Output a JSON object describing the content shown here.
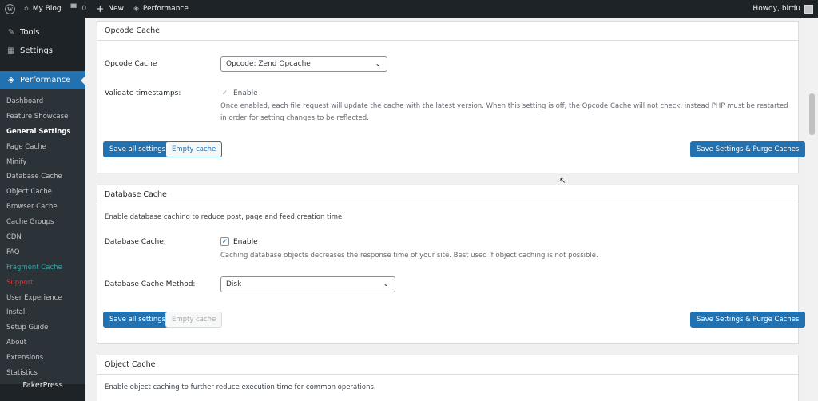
{
  "adminbar": {
    "site_name": "My Blog",
    "comments_count": "0",
    "new_label": "New",
    "performance_label": "Performance",
    "howdy": "Howdy, birdu"
  },
  "sidebar": {
    "tools": "Tools",
    "settings": "Settings",
    "performance": "Performance",
    "items": [
      "Dashboard",
      "Feature Showcase",
      "General Settings",
      "Page Cache",
      "Minify",
      "Database Cache",
      "Object Cache",
      "Browser Cache",
      "Cache Groups",
      "CDN",
      "FAQ",
      "Fragment Cache",
      "Support",
      "User Experience",
      "Install",
      "Setup Guide",
      "About",
      "Extensions",
      "Statistics"
    ],
    "fakerpress": "FakerPress"
  },
  "opcode": {
    "title": "Opcode Cache",
    "cache_label": "Opcode Cache",
    "cache_value": "Opcode: Zend Opcache",
    "validate_label": "Validate timestamps:",
    "enable_label": "Enable",
    "description": "Once enabled, each file request will update the cache with the latest version. When this setting is off, the Opcode Cache will not check, instead PHP must be restarted in order for setting changes to be reflected.",
    "save_all": "Save all settings",
    "empty_cache": "Empty cache",
    "save_purge": "Save Settings & Purge Caches"
  },
  "dbcache": {
    "title": "Database Cache",
    "intro": "Enable database caching to reduce post, page and feed creation time.",
    "cache_label": "Database Cache:",
    "enable_label": "Enable",
    "description": "Caching database objects decreases the response time of your site. Best used if object caching is not possible.",
    "method_label": "Database Cache Method:",
    "method_value": "Disk",
    "save_all": "Save all settings",
    "empty_cache": "Empty cache",
    "save_purge": "Save Settings & Purge Caches"
  },
  "objcache": {
    "title": "Object Cache",
    "intro": "Enable object caching to further reduce execution time for common operations."
  }
}
